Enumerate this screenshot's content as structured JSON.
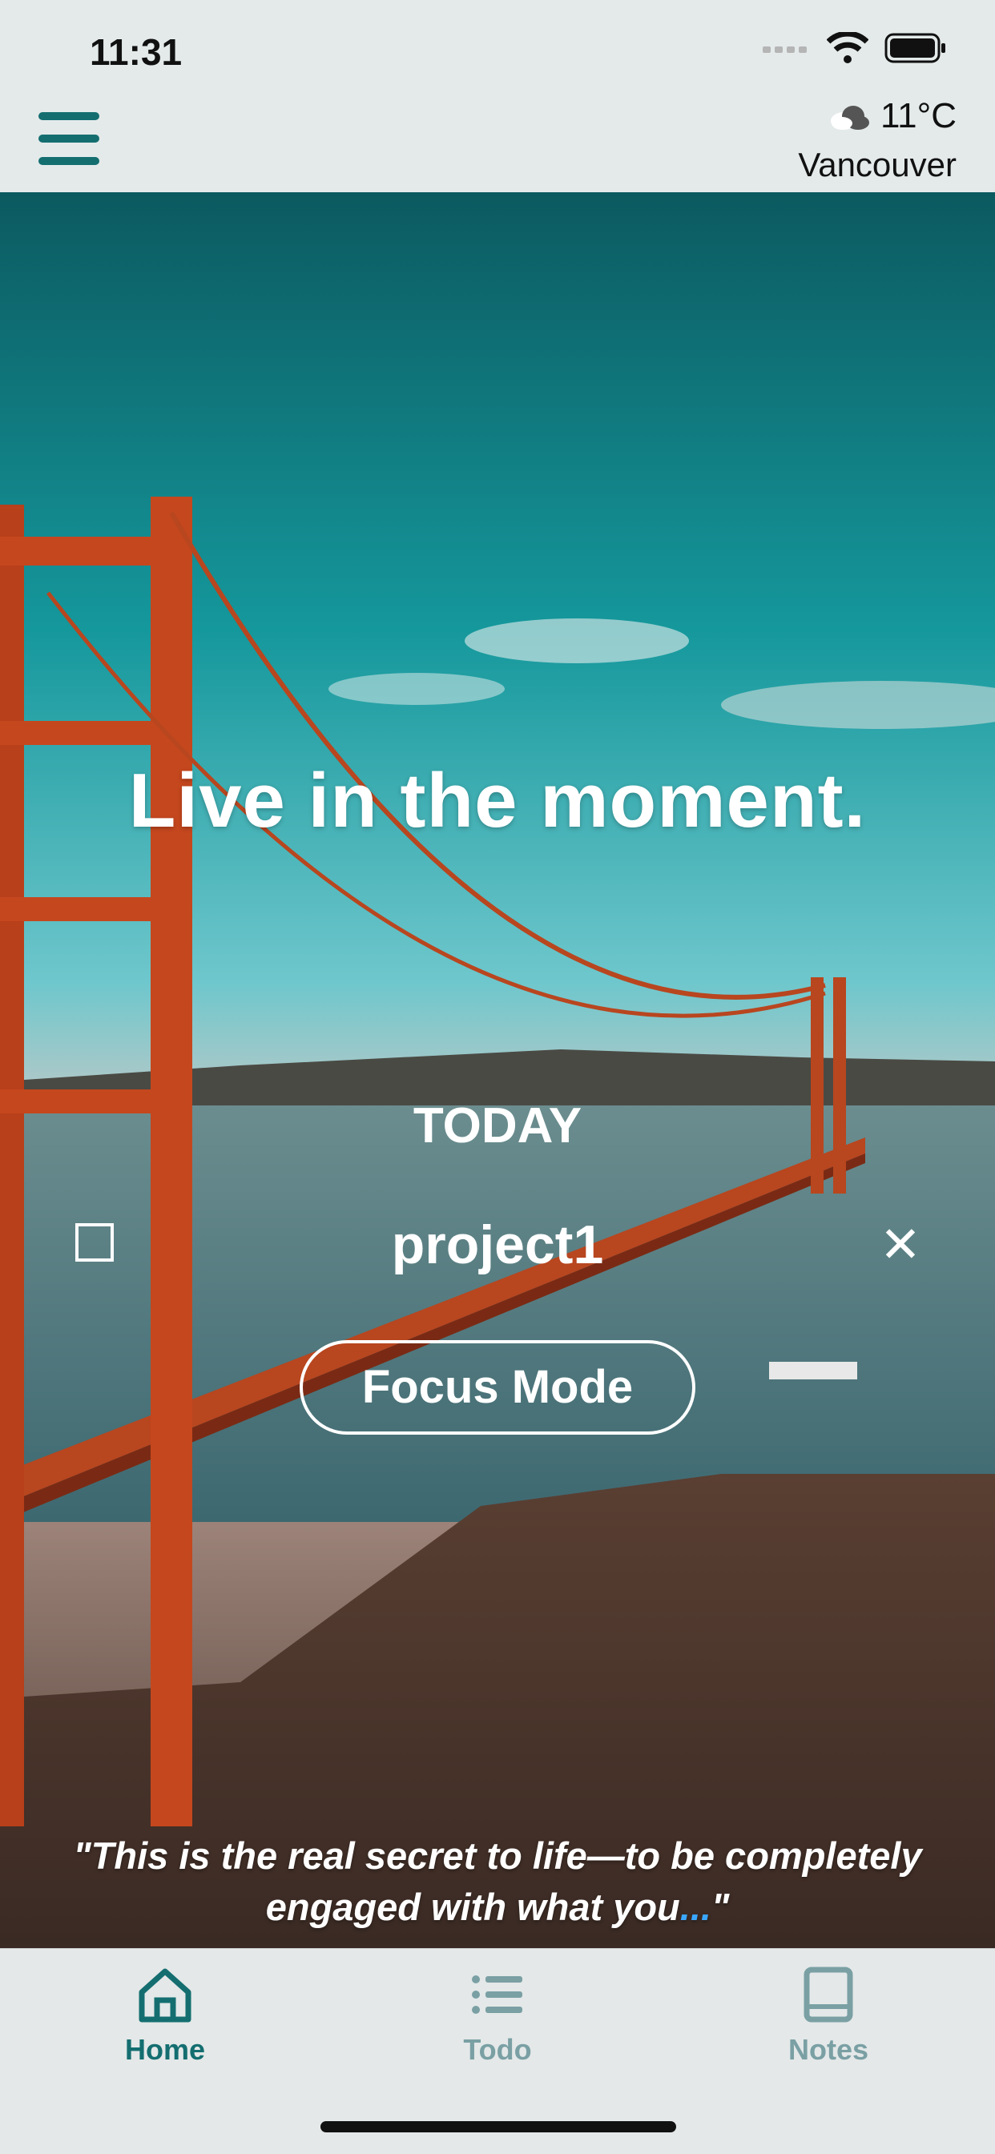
{
  "status_bar": {
    "time": "11:31"
  },
  "header": {
    "weather": {
      "temperature": "11°C",
      "city": "Vancouver",
      "icon": "cloud-icon"
    }
  },
  "hero": {
    "motto": "Live in the moment.",
    "section_title": "TODAY",
    "task": {
      "label": "project1",
      "checked": false
    },
    "focus_button": "Focus Mode",
    "quote": "\"This is the real secret to life—to be completely engaged with what you",
    "quote_ellipsis": "...",
    "quote_close": "\""
  },
  "tabs": [
    {
      "label": "Home",
      "icon": "home-icon",
      "active": true
    },
    {
      "label": "Todo",
      "icon": "list-icon",
      "active": false
    },
    {
      "label": "Notes",
      "icon": "book-icon",
      "active": false
    }
  ],
  "colors": {
    "accent": "#146e70",
    "inactive": "#7aa0a4"
  }
}
